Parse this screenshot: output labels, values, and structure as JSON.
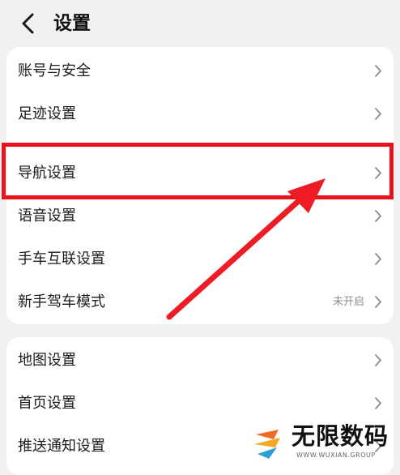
{
  "header": {
    "title": "设置"
  },
  "sections": [
    {
      "items": [
        {
          "label": "账号与安全"
        },
        {
          "label": "足迹设置"
        },
        {
          "label": "导航设置"
        },
        {
          "label": "语音设置"
        },
        {
          "label": "手车互联设置"
        },
        {
          "label": "新手驾车模式",
          "value": "未开启"
        }
      ]
    },
    {
      "items": [
        {
          "label": "地图设置"
        },
        {
          "label": "首页设置"
        },
        {
          "label": "推送通知设置"
        }
      ]
    }
  ],
  "annotation": {
    "highlighted_item": "导航设置",
    "color": "#e8131b"
  },
  "watermark": {
    "name": "无限数码",
    "subtitle": "WWW.WUXIAN.GROUP"
  }
}
